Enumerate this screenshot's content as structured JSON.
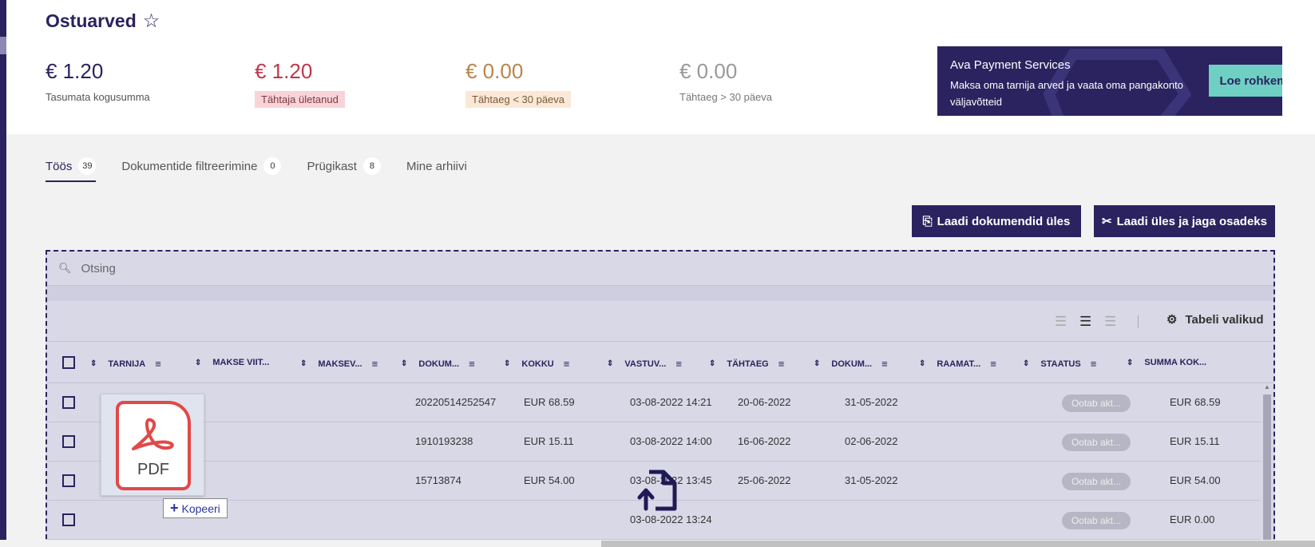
{
  "page": {
    "title": "Ostuarved"
  },
  "stats": [
    {
      "amount": "€ 1.20",
      "label": "Tasumata kogusumma",
      "color": "#2a235f"
    },
    {
      "amount": "€ 1.20",
      "label": "Tähtaja ületanud",
      "color": "#c0364b"
    },
    {
      "amount": "€ 0.00",
      "label": "Tähtaeg < 30 päeva",
      "color": "#b8864c"
    },
    {
      "amount": "€ 0.00",
      "label": "Tähtaeg > 30 päeva",
      "color": "#999999"
    }
  ],
  "promo": {
    "title": "Ava Payment Services",
    "text": "Maksa oma tarnija arved ja vaata oma pangakonto väljavõtteid",
    "button": "Loe rohkem"
  },
  "tabs": [
    {
      "label": "Töös",
      "count": "39"
    },
    {
      "label": "Dokumentide filtreerimine",
      "count": "0"
    },
    {
      "label": "Prügikast",
      "count": "8"
    },
    {
      "label": "Mine arhiivi",
      "count": ""
    }
  ],
  "actions": {
    "upload": "Laadi dokumendid üles",
    "upload_split": "Laadi üles ja jaga osadeks"
  },
  "search": {
    "placeholder": "Otsing"
  },
  "table_options": "Tabeli valikud",
  "columns": [
    "TARNIJA",
    "MAKSE VIIT...",
    "MAKSEV...",
    "DOKUM...",
    "KOKKU",
    "VASTUV...",
    "TÄHTAEG",
    "DOKUM...",
    "RAAMAT...",
    "STAATUS",
    "SUMMA KOK..."
  ],
  "rows": [
    {
      "doc": "20220514252547",
      "total": "EUR 68.59",
      "received": "03-08-2022 14:21",
      "due": "20-06-2022",
      "docdate": "31-05-2022",
      "status": "Ootab akt...",
      "sum": "EUR 68.59"
    },
    {
      "doc": "1910193238",
      "total": "EUR 15.11",
      "received": "03-08-2022 14:00",
      "due": "16-06-2022",
      "docdate": "02-06-2022",
      "status": "Ootab akt...",
      "sum": "EUR 15.11"
    },
    {
      "doc": "15713874",
      "total": "EUR 54.00",
      "received": "03-08-2022 13:45",
      "due": "25-06-2022",
      "docdate": "31-05-2022",
      "status": "Ootab akt...",
      "sum": "EUR 54.00"
    },
    {
      "doc": "",
      "total": "",
      "received": "03-08-2022 13:24",
      "due": "",
      "docdate": "",
      "status": "Ootab akt...",
      "sum": "EUR 0.00"
    }
  ],
  "drag": {
    "file_label": "PDF",
    "copy_label": "Kopeeri"
  }
}
